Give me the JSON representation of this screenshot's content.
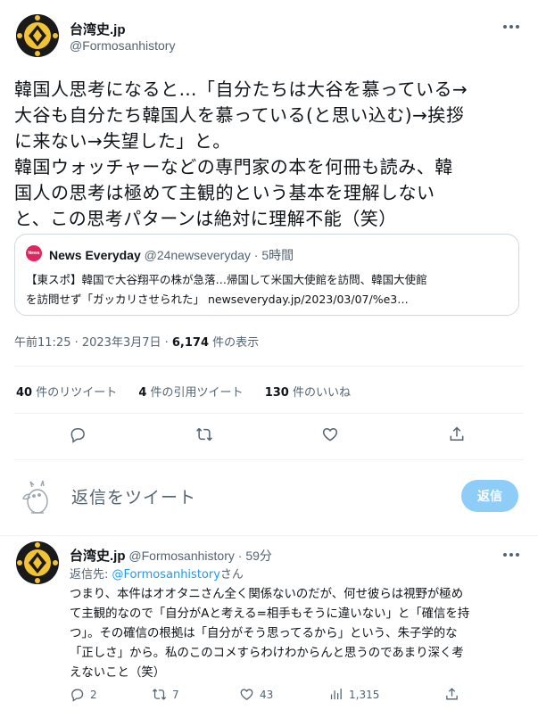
{
  "tweet": {
    "display_name": "台湾史.jp",
    "handle": "@Formosanhistory",
    "body_lines": [
      "韓国人思考になると…「自分たちは大谷を慕っている→",
      "大谷も自分たち韓国人を慕っている(と思い込む)→挨拶",
      "に来ない→失望した」と。",
      "韓国ウォッチャーなどの専門家の本を何冊も読み、韓",
      "国人の思考は極めて主観的という基本を理解しない",
      "と、この思考パターンは絶対に理解不能（笑）"
    ],
    "quote": {
      "source_name": "News Everyday",
      "source_handle": "@24newseveryday",
      "dot": "·",
      "time": "5時間",
      "logo_text": "News",
      "text_lines": [
        "【東スポ】韓国で大谷翔平の株が急落…帰国して米国大使館を訪問、韓国大使館",
        "を訪問せず「ガッカリさせられた」 newseveryday.jp/2023/03/07/%e3…"
      ]
    },
    "timestamp": "午前11:25 · 2023年3月7日 · ",
    "views_count": "6,174",
    "views_label": " 件の表示",
    "stats": {
      "retweets_count": "40",
      "retweets_label": " 件のリツイート",
      "quotes_count": "4",
      "quotes_label": " 件の引用ツイート",
      "likes_count": "130",
      "likes_label": " 件のいいね"
    }
  },
  "reply_composer": {
    "placeholder": "返信をツイート",
    "button_label": "返信"
  },
  "reply": {
    "display_name": "台湾史.jp",
    "handle": "@Formosanhistory",
    "dot": "·",
    "time": "59分",
    "replying_to_prefix": "返信先: ",
    "replying_to_handle": "@Formosanhistory",
    "replying_to_suffix": "さん",
    "body_lines": [
      "つまり、本件はオオタニさん全く関係ないのだが、何せ彼らは視野が極め",
      "て主観的なので「自分がAと考える=相手もそうに違いない」と「確信を持",
      "つ」。その確信の根拠は「自分がそう思ってるから」という、朱子学的な",
      "「正しさ」から。私のこのコメすらわけわからんと思うのであまり深く考",
      "えないこと（笑）"
    ],
    "actions": {
      "replies": "2",
      "retweets": "7",
      "likes": "43",
      "views": "1,315"
    }
  },
  "colors": {
    "accent": "#1d9bf0",
    "accent_disabled": "#8ecdf8",
    "text": "#0f1419",
    "muted": "#536471",
    "border": "#cfd9de",
    "divider": "#eff3f4",
    "news_red": "#e0245e"
  },
  "icons": [
    "more-icon",
    "reply-icon",
    "retweet-icon",
    "like-icon",
    "share-icon",
    "views-icon",
    "moomin-avatar-icon"
  ]
}
